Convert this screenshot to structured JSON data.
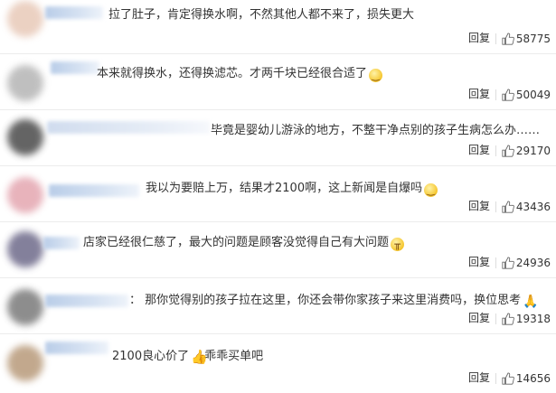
{
  "actions": {
    "reply_label": "回复"
  },
  "comments": [
    {
      "text": "拉了肚子，肯定得换水啊，不然其他人都不来了，损失更大",
      "emoji": "",
      "likes": "58775",
      "avatar_color": "#e8c9b8"
    },
    {
      "text": "本来就得换水，还得换滤芯。才两千块已经很合适了",
      "emoji": "smile",
      "likes": "50049",
      "avatar_color": "#b5b5b5"
    },
    {
      "text": "毕竟是婴幼儿游泳的地方，不整干净点别的孩子生病怎么办……",
      "emoji": "",
      "likes": "29170",
      "avatar_color": "#4a4a4a"
    },
    {
      "text": "我以为要赔上万，结果才2100啊，这上新闻是自爆吗",
      "emoji": "smile",
      "likes": "43436",
      "avatar_color": "#e4a6b0"
    },
    {
      "text": "店家已经很仁慈了，最大的问题是顾客没觉得自己有大问题",
      "emoji": "cry",
      "likes": "24936",
      "avatar_color": "#6e6a8a"
    },
    {
      "text": "：  那你觉得别的孩子拉在这里，你还会带你家孩子来这里消费吗，换位思考",
      "emoji": "pray",
      "likes": "19318",
      "avatar_color": "#7a7a7a"
    },
    {
      "text": "2100良心价了",
      "text2": "乖乖买单吧",
      "emoji": "thumb",
      "likes": "14656",
      "avatar_color": "#b89a7a"
    }
  ]
}
